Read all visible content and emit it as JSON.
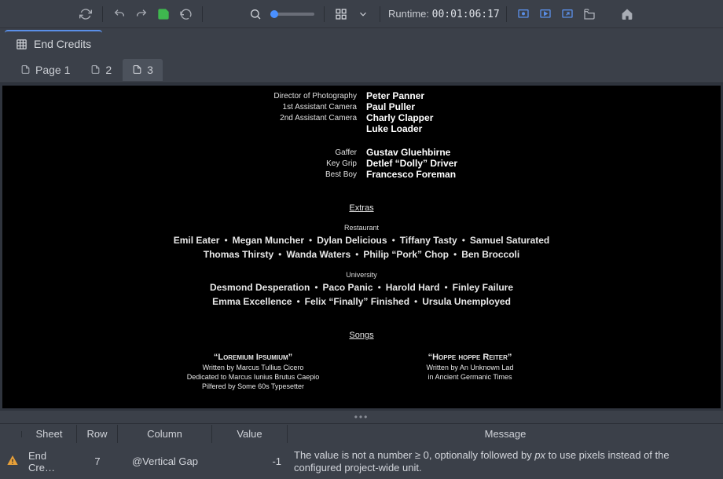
{
  "toolbar": {
    "runtime_label": "Runtime:",
    "runtime_value": "00:01:06:17"
  },
  "tabs": {
    "main": "End Credits"
  },
  "pagetabs": [
    "Page 1",
    "2",
    "3"
  ],
  "credits": {
    "crew": [
      {
        "role": "Director of Photography",
        "name": "Peter Panner"
      },
      {
        "role": "1st Assistant Camera",
        "name": "Paul Puller"
      },
      {
        "role": "2nd Assistant Camera",
        "name": "Charly Clapper"
      },
      {
        "role": "",
        "name": "Luke Loader"
      },
      {
        "role": "Gaffer",
        "name": "Gustav Gluehbirne"
      },
      {
        "role": "Key Grip",
        "name": "Detlef “Dolly” Driver"
      },
      {
        "role": "Best Boy",
        "name": "Francesco Foreman"
      }
    ],
    "extras_title": "Extras",
    "groups": [
      {
        "header": "Restaurant",
        "lines": [
          [
            "Emil Eater",
            "Megan Muncher",
            "Dylan Delicious",
            "Tiffany Tasty",
            "Samuel Saturated"
          ],
          [
            "Thomas Thirsty",
            "Wanda Waters",
            "Philip “Pork” Chop",
            "Ben Broccoli"
          ]
        ]
      },
      {
        "header": "University",
        "lines": [
          [
            "Desmond Desperation",
            "Paco Panic",
            "Harold Hard",
            "Finley Failure"
          ],
          [
            "Emma Excellence",
            "Felix “Finally” Finished",
            "Ursula Unemployed"
          ]
        ]
      }
    ],
    "songs_title": "Songs",
    "songs": [
      {
        "title_quoted": "“Loremium Ipsumium”",
        "lines": [
          "Written by Marcus Tullius Cicero",
          "Dedicated to Marcus Iunius Brutus Caepio",
          "Pilfered by Some 60s Typesetter"
        ]
      },
      {
        "title_quoted": "“Hoppe hoppe Reiter”",
        "lines": [
          "Written by An Unknown Lad",
          "in Ancient Germanic Times"
        ]
      }
    ]
  },
  "problems": {
    "headers": {
      "sheet": "Sheet",
      "row": "Row",
      "column": "Column",
      "value": "Value",
      "message": "Message"
    },
    "rows": [
      {
        "sheet": "End Cre…",
        "row": "7",
        "column": "@Vertical Gap",
        "value": "-1",
        "message_pre": "The value is not a number ≥ 0, optionally followed by ",
        "message_em": "px",
        "message_post": " to use pixels instead of the configured project-wide unit."
      }
    ]
  }
}
